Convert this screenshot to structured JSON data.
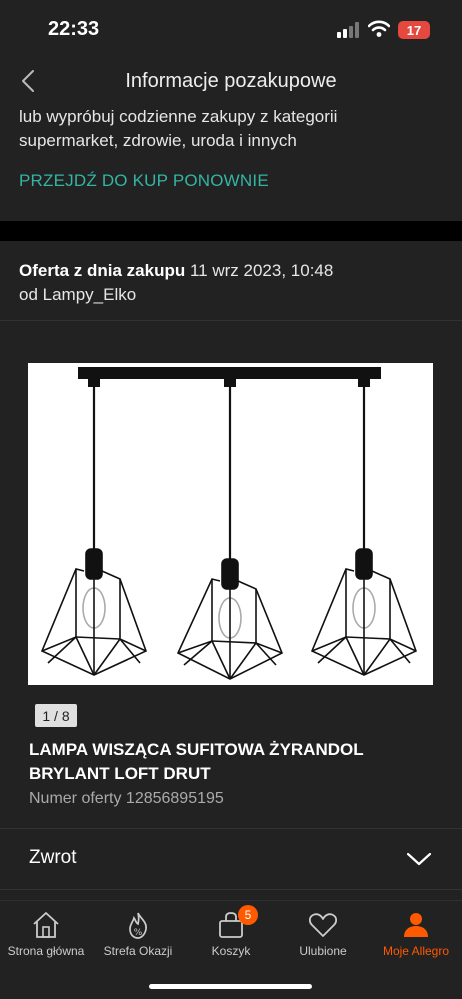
{
  "status_bar": {
    "time": "22:33",
    "battery": "17"
  },
  "nav": {
    "title": "Informacje pozakupowe"
  },
  "promo": {
    "text": "lub wypróbuj codzienne zakupy z kategorii supermarket, zdrowie, uroda i innych",
    "link": "PRZEJDŹ DO KUP PONOWNIE"
  },
  "offer": {
    "label": "Oferta z dnia zakupu",
    "date": "11 wrz 2023, 10:48",
    "seller": "od Lampy_Elko",
    "image_counter": "1 / 8",
    "title": "LAMPA WISZĄCA SUFITOWA ŻYRANDOL BRYLANT LOFT DRUT",
    "number": "Numer oferty 12856895195"
  },
  "return_section": {
    "label": "Zwrot"
  },
  "tabs": [
    {
      "label": "Strona główna",
      "icon": "home-icon"
    },
    {
      "label": "Strefa Okazji",
      "icon": "flame-percent-icon"
    },
    {
      "label": "Koszyk",
      "icon": "cart-icon",
      "badge": "5"
    },
    {
      "label": "Ulubione",
      "icon": "heart-icon"
    },
    {
      "label": "Moje Allegro",
      "icon": "user-icon",
      "active": true
    }
  ],
  "colors": {
    "accent": "#ff5a00",
    "link": "#33b5a4",
    "surface": "#222222"
  }
}
